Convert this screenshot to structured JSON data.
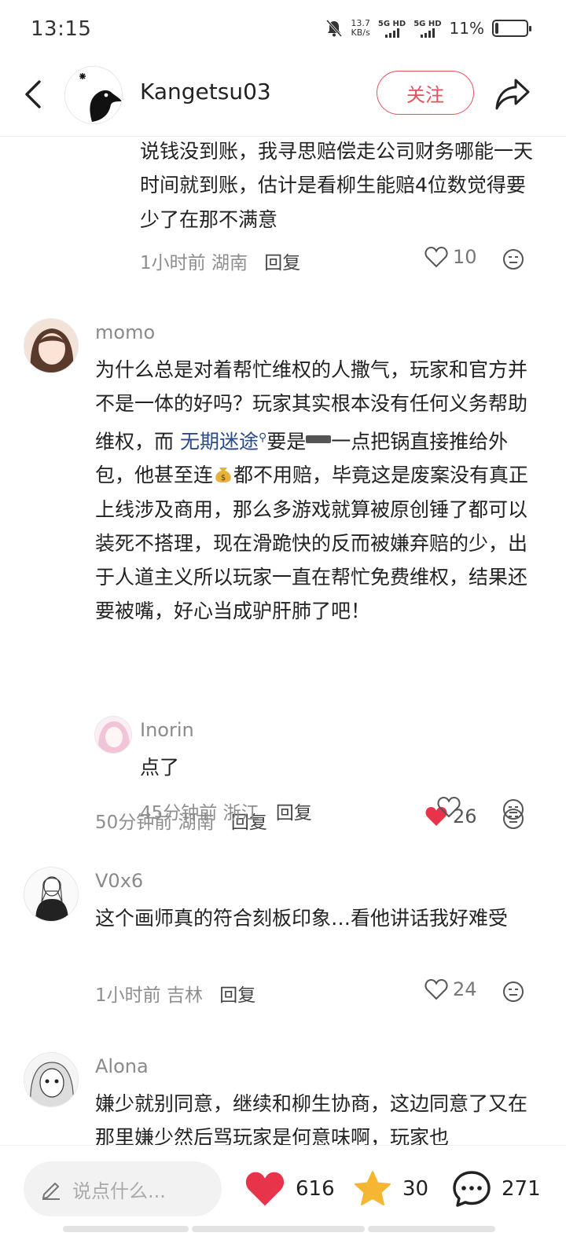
{
  "status_bar": {
    "time": "13:15",
    "net_speed_value": "13.7",
    "net_speed_unit": "KB/s",
    "sim1": "5G HD",
    "sim2": "5G HD",
    "battery_pct": "11%",
    "battery_level": 0.11
  },
  "header": {
    "author": "Kangetsu03",
    "follow_label": "关注",
    "icons": {
      "back": "back-arrow-icon",
      "share": "share-icon"
    }
  },
  "comments": [
    {
      "text": "说钱没到账，我寻思赔偿走公司财务哪能一天时间就到账，估计是看柳生能赔4位数觉得要少了在那不满意",
      "time": "1小时前",
      "location": "湖南",
      "reply_label": "回复",
      "likes": "10",
      "liked": false
    },
    {
      "user": "momo",
      "text_part1": "为什么总是对着帮忙维权的人撒气，玩家和官方并不是一体的好吗？玩家其实根本没有任何义务帮助维权，而 ",
      "topic": "无期迷途",
      "text_part2": "要是",
      "text_part3": "一点把锅直接推给外包，他甚至连",
      "text_part4": "都不用赔，毕竟这是废案没有真正上线涉及商用，那么多游戏就算被原创锤了都可以装死不搭理，现在滑跪快的反而被嫌弃赔的少，出于人道主义所以玩家一直在帮忙免费维权，结果还要被嘴，好心当成驴肝肺了吧！",
      "time": "50分钟前",
      "location": "湖南",
      "reply_label": "回复",
      "likes": "26",
      "liked": true,
      "like_color": "#e8344a"
    },
    {
      "user": "Inorin",
      "text": "点了",
      "time": "45分钟前",
      "location": "浙江",
      "reply_label": "回复",
      "likes": "",
      "liked": false
    },
    {
      "user": "V0x6",
      "text": "这个画师真的符合刻板印象…看他讲话我好难受",
      "time": "1小时前",
      "location": "吉林",
      "reply_label": "回复",
      "likes": "24",
      "liked": false
    },
    {
      "user": "Alona",
      "text": "嫌少就别同意，继续和柳生协商，这边同意了又在那里嫌少然后骂玩家是何意味啊，玩家也"
    }
  ],
  "bottom_bar": {
    "input_placeholder": "说点什么...",
    "likes": "616",
    "favorites": "30",
    "comments": "271",
    "like_color": "#e8344a",
    "star_color": "#f5b634"
  }
}
